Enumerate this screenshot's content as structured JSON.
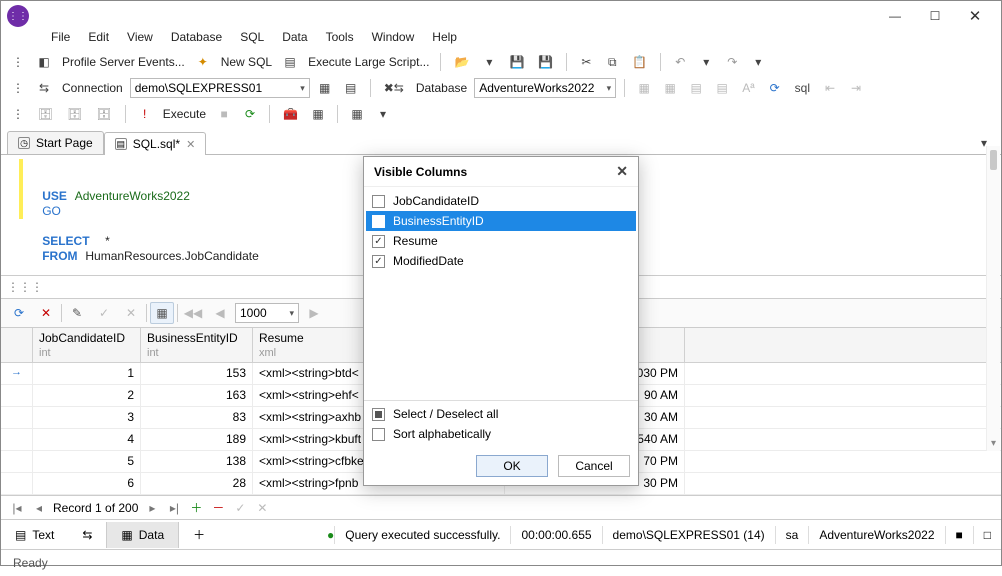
{
  "menus": [
    "File",
    "Edit",
    "View",
    "Database",
    "SQL",
    "Data",
    "Tools",
    "Window",
    "Help"
  ],
  "toolbar1": {
    "profile": "Profile Server Events...",
    "newsql": "New SQL",
    "execute_large": "Execute Large Script..."
  },
  "toolbar2": {
    "conn_label": "Connection",
    "conn_value": "demo\\SQLEXPRESS01",
    "db_label": "Database",
    "db_value": "AdventureWorks2022"
  },
  "toolbar3": {
    "execute": "Execute"
  },
  "tabs": {
    "start": "Start Page",
    "sql": "SQL.sql*"
  },
  "code": {
    "l1a": "USE",
    "l1b": "AdventureWorks2022",
    "l2": "GO",
    "l3a": "SELECT",
    "l3b": "*",
    "l4a": "FROM",
    "l4b": "HumanResources.JobCandidate"
  },
  "gridtoolbar": {
    "page_size": "1000"
  },
  "columns": {
    "c1": "JobCandidateID",
    "t1": "int",
    "c2": "BusinessEntityID",
    "t2": "int",
    "c3": "Resume",
    "t3": "xml",
    "c4": "ModifiedDate"
  },
  "rows": [
    {
      "a": "1",
      "b": "153",
      "c": "<xml><string>btd<",
      "d": "030 PM"
    },
    {
      "a": "2",
      "b": "163",
      "c": "<xml><string>ehf<",
      "d": "90 AM"
    },
    {
      "a": "3",
      "b": "83",
      "c": "<xml><string>axhb",
      "d": "30 AM"
    },
    {
      "a": "4",
      "b": "189",
      "c": "<xml><string>kbuft",
      "d": "540 AM"
    },
    {
      "a": "5",
      "b": "138",
      "c": "<xml><string>cfbke",
      "d": "70 PM"
    },
    {
      "a": "6",
      "b": "28",
      "c": "<xml><string>fpnb",
      "d": "30 PM"
    }
  ],
  "nav": {
    "record": "Record 1 of 200"
  },
  "bottomtabs": {
    "text": "Text",
    "data": "Data"
  },
  "status": {
    "msg": "Query executed successfully.",
    "time": "00:00:00.655",
    "conn": "demo\\SQLEXPRESS01 (14)",
    "user": "sa",
    "db": "AdventureWorks2022"
  },
  "ready": "Ready",
  "modal": {
    "title": "Visible Columns",
    "items": [
      {
        "label": "JobCandidateID",
        "checked": false,
        "sel": false
      },
      {
        "label": "BusinessEntityID",
        "checked": false,
        "sel": true
      },
      {
        "label": "Resume",
        "checked": true,
        "sel": false
      },
      {
        "label": "ModifiedDate",
        "checked": true,
        "sel": false
      }
    ],
    "select_all": "Select / Deselect all",
    "sort_alpha": "Sort alphabetically",
    "ok": "OK",
    "cancel": "Cancel"
  }
}
